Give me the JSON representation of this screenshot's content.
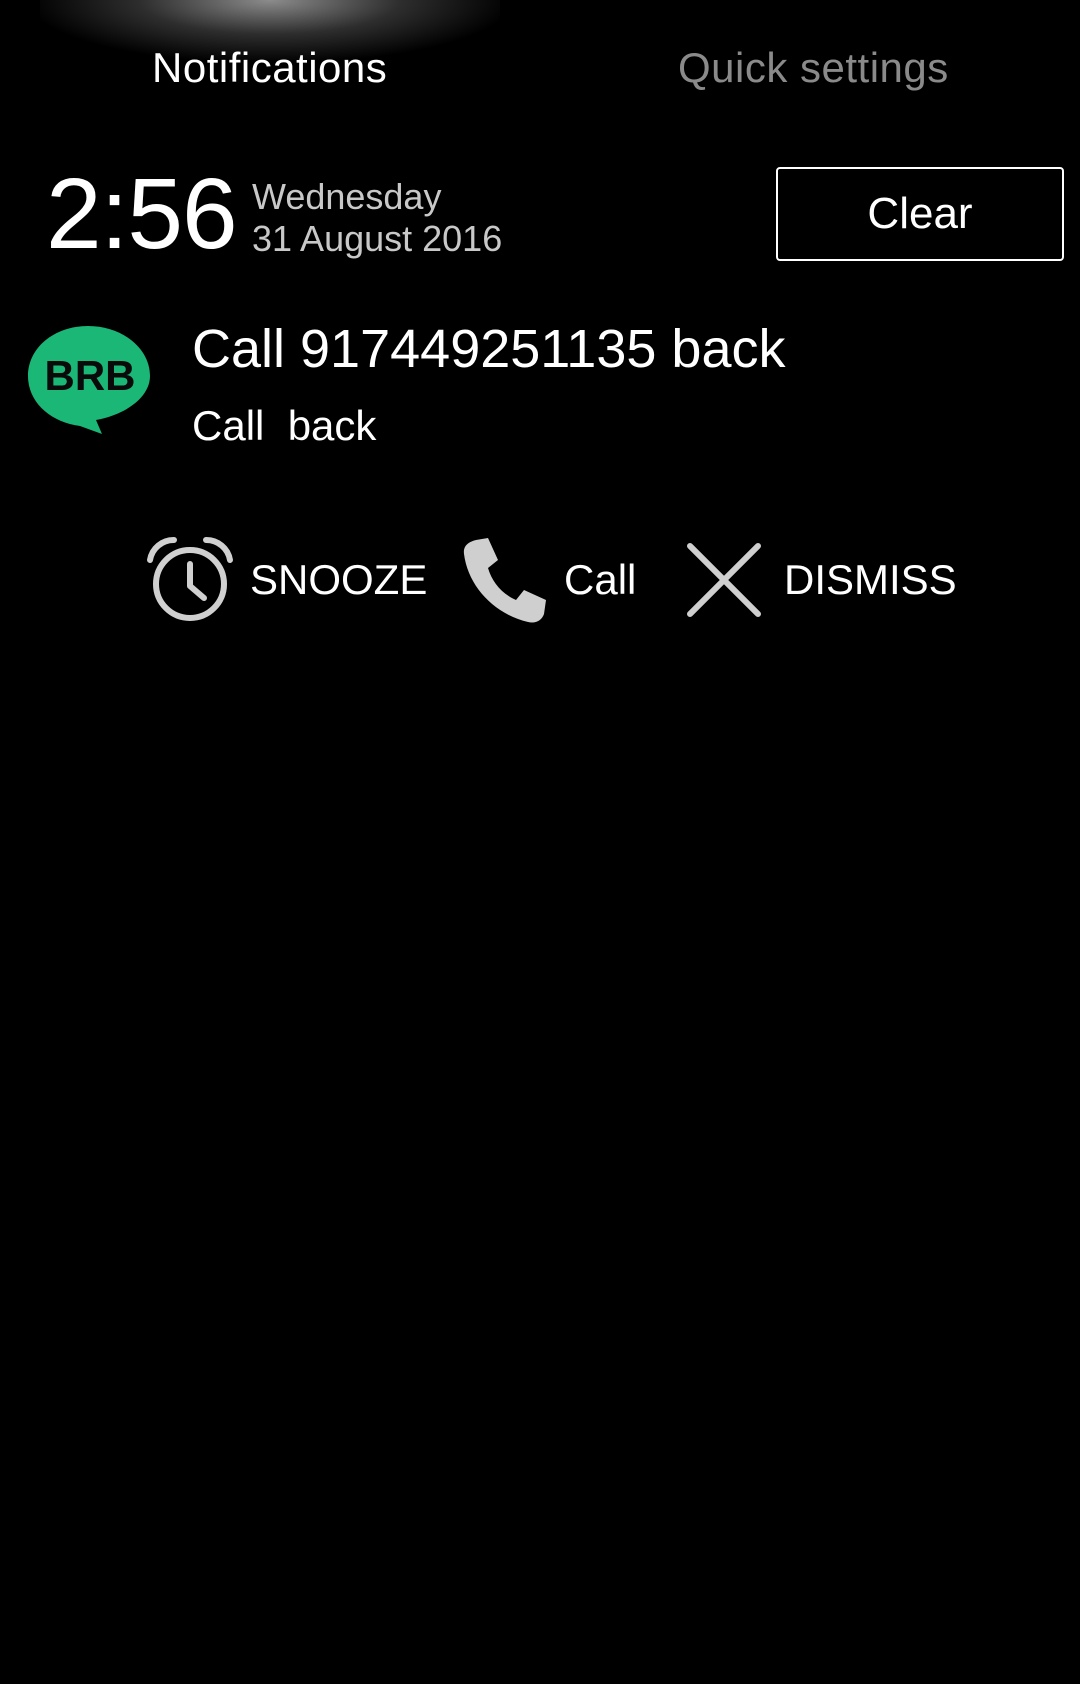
{
  "tabs": {
    "notifications": "Notifications",
    "quick_settings": "Quick settings"
  },
  "header": {
    "time": "2:56",
    "weekday": "Wednesday",
    "date": "31 August 2016",
    "clear_label": "Clear"
  },
  "notification": {
    "app_icon": "brb-app-icon",
    "app_icon_text": "BRB",
    "title": "Call 917449251135 back",
    "text": "Call  back",
    "accent_color": "#1ab777"
  },
  "actions": [
    {
      "icon": "alarm-clock-icon",
      "label": "SNOOZE"
    },
    {
      "icon": "phone-icon",
      "label": "Call"
    },
    {
      "icon": "close-icon",
      "label": "DISMISS"
    }
  ]
}
